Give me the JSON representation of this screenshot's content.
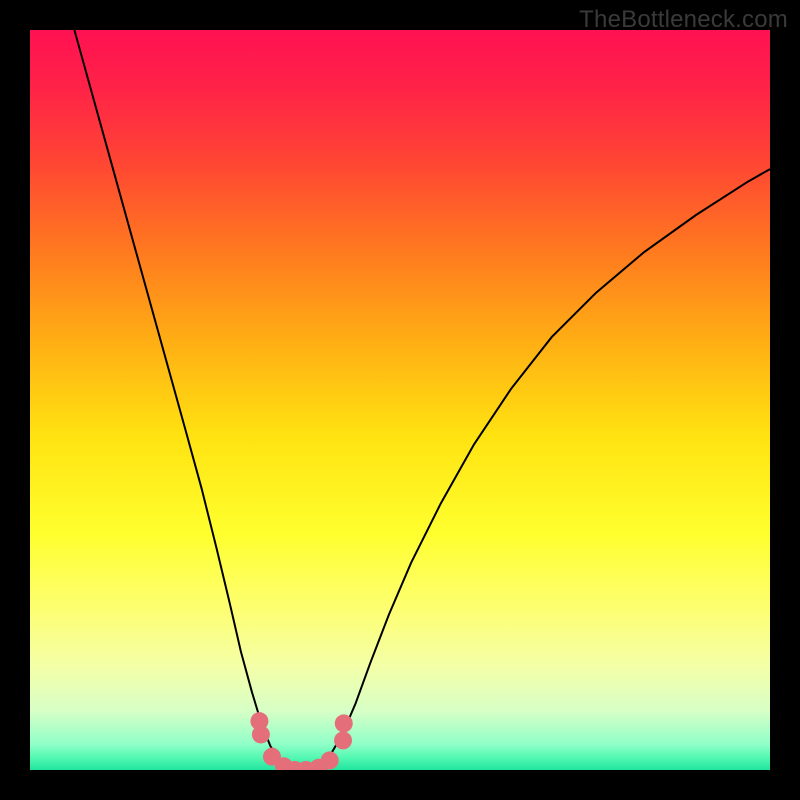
{
  "watermark": "TheBottleneck.com",
  "chart_data": {
    "type": "line",
    "title": "",
    "xlabel": "",
    "ylabel": "",
    "xlim": [
      0,
      1
    ],
    "ylim": [
      0,
      1
    ],
    "background_gradient": {
      "stops": [
        {
          "offset": 0.0,
          "color": "#ff1152"
        },
        {
          "offset": 0.08,
          "color": "#ff2347"
        },
        {
          "offset": 0.18,
          "color": "#ff4633"
        },
        {
          "offset": 0.3,
          "color": "#ff7a1f"
        },
        {
          "offset": 0.42,
          "color": "#ffae14"
        },
        {
          "offset": 0.55,
          "color": "#ffe311"
        },
        {
          "offset": 0.68,
          "color": "#ffff2e"
        },
        {
          "offset": 0.78,
          "color": "#fdff70"
        },
        {
          "offset": 0.86,
          "color": "#f4ffa8"
        },
        {
          "offset": 0.92,
          "color": "#d7ffc6"
        },
        {
          "offset": 0.965,
          "color": "#90ffc8"
        },
        {
          "offset": 0.985,
          "color": "#4ef7b0"
        },
        {
          "offset": 1.0,
          "color": "#21e39e"
        }
      ]
    },
    "series": [
      {
        "name": "bottleneck-curve",
        "color": "#000000",
        "style": "line",
        "points": [
          {
            "x": 0.06,
            "y": 1.0
          },
          {
            "x": 0.085,
            "y": 0.91
          },
          {
            "x": 0.11,
            "y": 0.82
          },
          {
            "x": 0.135,
            "y": 0.73
          },
          {
            "x": 0.16,
            "y": 0.64
          },
          {
            "x": 0.185,
            "y": 0.55
          },
          {
            "x": 0.21,
            "y": 0.46
          },
          {
            "x": 0.232,
            "y": 0.38
          },
          {
            "x": 0.252,
            "y": 0.3
          },
          {
            "x": 0.27,
            "y": 0.225
          },
          {
            "x": 0.285,
            "y": 0.16
          },
          {
            "x": 0.3,
            "y": 0.105
          },
          {
            "x": 0.313,
            "y": 0.062
          },
          {
            "x": 0.325,
            "y": 0.032
          },
          {
            "x": 0.337,
            "y": 0.014
          },
          {
            "x": 0.35,
            "y": 0.004
          },
          {
            "x": 0.365,
            "y": 0.0
          },
          {
            "x": 0.38,
            "y": 0.002
          },
          {
            "x": 0.395,
            "y": 0.01
          },
          {
            "x": 0.408,
            "y": 0.024
          },
          {
            "x": 0.422,
            "y": 0.048
          },
          {
            "x": 0.44,
            "y": 0.09
          },
          {
            "x": 0.46,
            "y": 0.145
          },
          {
            "x": 0.485,
            "y": 0.21
          },
          {
            "x": 0.515,
            "y": 0.28
          },
          {
            "x": 0.555,
            "y": 0.36
          },
          {
            "x": 0.6,
            "y": 0.44
          },
          {
            "x": 0.65,
            "y": 0.515
          },
          {
            "x": 0.705,
            "y": 0.585
          },
          {
            "x": 0.765,
            "y": 0.645
          },
          {
            "x": 0.83,
            "y": 0.7
          },
          {
            "x": 0.9,
            "y": 0.75
          },
          {
            "x": 0.97,
            "y": 0.795
          },
          {
            "x": 1.0,
            "y": 0.812
          }
        ]
      },
      {
        "name": "data-markers",
        "color": "#e46f7a",
        "style": "scatter",
        "points": [
          {
            "x": 0.31,
            "y": 0.066
          },
          {
            "x": 0.312,
            "y": 0.048
          },
          {
            "x": 0.327,
            "y": 0.018
          },
          {
            "x": 0.343,
            "y": 0.005
          },
          {
            "x": 0.358,
            "y": 0.0
          },
          {
            "x": 0.373,
            "y": 0.0
          },
          {
            "x": 0.39,
            "y": 0.003
          },
          {
            "x": 0.405,
            "y": 0.013
          },
          {
            "x": 0.423,
            "y": 0.04
          },
          {
            "x": 0.424,
            "y": 0.063
          }
        ]
      }
    ]
  }
}
